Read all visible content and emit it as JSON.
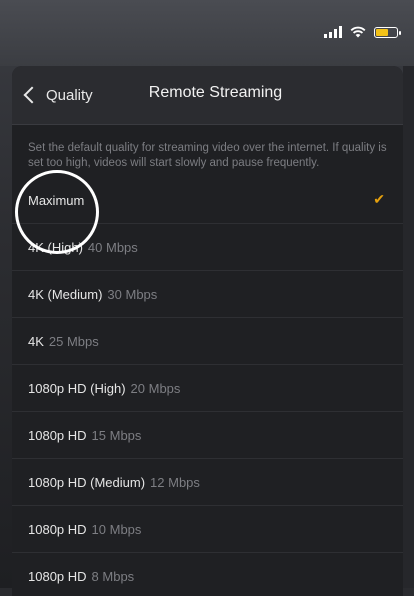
{
  "colors": {
    "accent": "#e5a00d",
    "battery": "#f3c218"
  },
  "status_bar": {
    "icons": [
      "signal-icon",
      "wifi-icon",
      "battery-icon"
    ],
    "battery_level": 0.55
  },
  "nav": {
    "back_label": "Quality",
    "title": "Remote Streaming"
  },
  "description": "Set the default quality for streaming video over the internet. If quality is set too high, videos will start slowly and pause frequently.",
  "options": [
    {
      "name": "Maximum",
      "rate": "",
      "selected": true
    },
    {
      "name": "4K (High)",
      "rate": "40 Mbps"
    },
    {
      "name": "4K (Medium)",
      "rate": "30 Mbps"
    },
    {
      "name": "4K",
      "rate": "25 Mbps"
    },
    {
      "name": "1080p HD (High)",
      "rate": "20 Mbps"
    },
    {
      "name": "1080p HD",
      "rate": "15 Mbps"
    },
    {
      "name": "1080p HD (Medium)",
      "rate": "12 Mbps"
    },
    {
      "name": "1080p HD",
      "rate": "10 Mbps"
    },
    {
      "name": "1080p HD",
      "rate": "8 Mbps"
    }
  ],
  "check_glyph": "✔"
}
